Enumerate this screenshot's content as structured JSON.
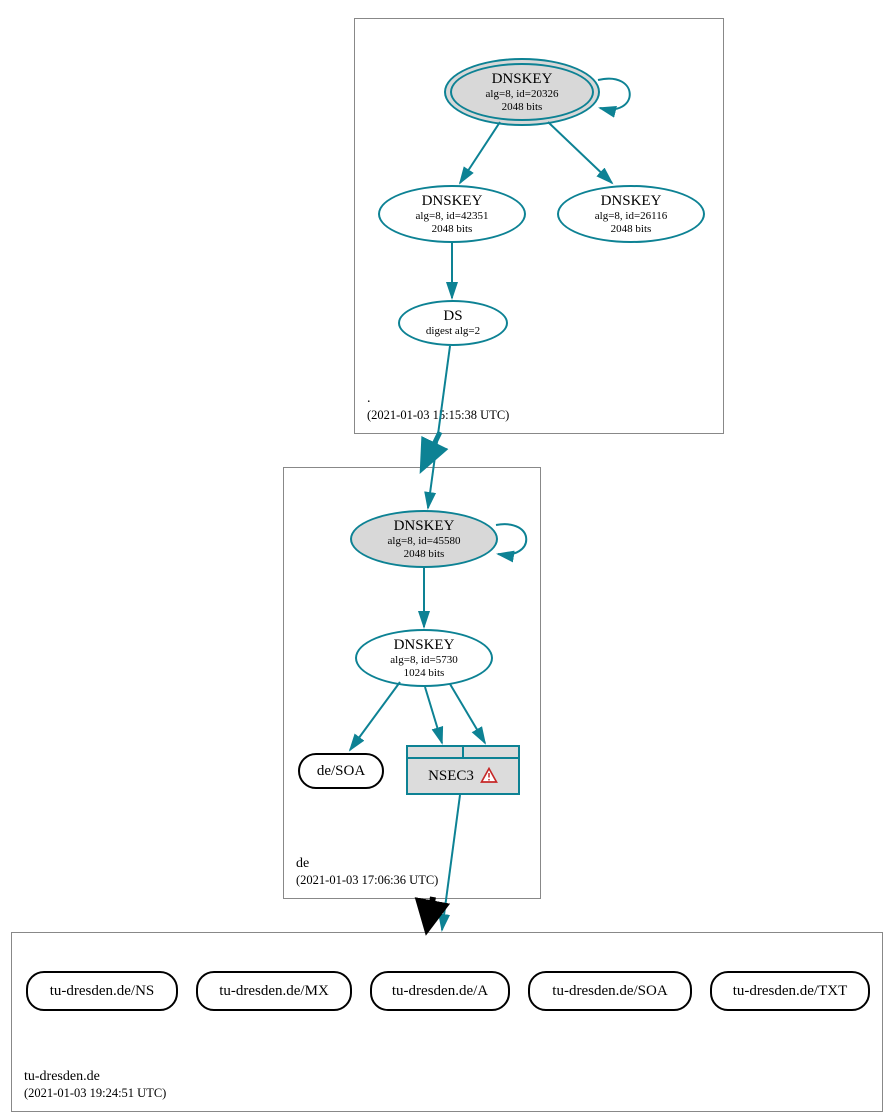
{
  "colors": {
    "teal": "#0d8294",
    "gray_fill": "#d8d8d8",
    "black": "#000000",
    "warn_red": "#c62828"
  },
  "zones": {
    "root": {
      "name": ".",
      "timestamp": "(2021-01-03 15:15:38 UTC)"
    },
    "de": {
      "name": "de",
      "timestamp": "(2021-01-03 17:06:36 UTC)"
    },
    "tud": {
      "name": "tu-dresden.de",
      "timestamp": "(2021-01-03 19:24:51 UTC)"
    }
  },
  "nodes": {
    "root_ksk": {
      "title": "DNSKEY",
      "line1": "alg=8, id=20326",
      "line2": "2048 bits"
    },
    "root_zsk1": {
      "title": "DNSKEY",
      "line1": "alg=8, id=42351",
      "line2": "2048 bits"
    },
    "root_zsk2": {
      "title": "DNSKEY",
      "line1": "alg=8, id=26116",
      "line2": "2048 bits"
    },
    "root_ds": {
      "title": "DS",
      "line1": "digest alg=2"
    },
    "de_ksk": {
      "title": "DNSKEY",
      "line1": "alg=8, id=45580",
      "line2": "2048 bits"
    },
    "de_zsk": {
      "title": "DNSKEY",
      "line1": "alg=8, id=5730",
      "line2": "1024 bits"
    },
    "de_soa": {
      "label": "de/SOA"
    },
    "de_nsec3": {
      "label": "NSEC3"
    },
    "tud_ns": {
      "label": "tu-dresden.de/NS"
    },
    "tud_mx": {
      "label": "tu-dresden.de/MX"
    },
    "tud_a": {
      "label": "tu-dresden.de/A"
    },
    "tud_soa": {
      "label": "tu-dresden.de/SOA"
    },
    "tud_txt": {
      "label": "tu-dresden.de/TXT"
    }
  }
}
